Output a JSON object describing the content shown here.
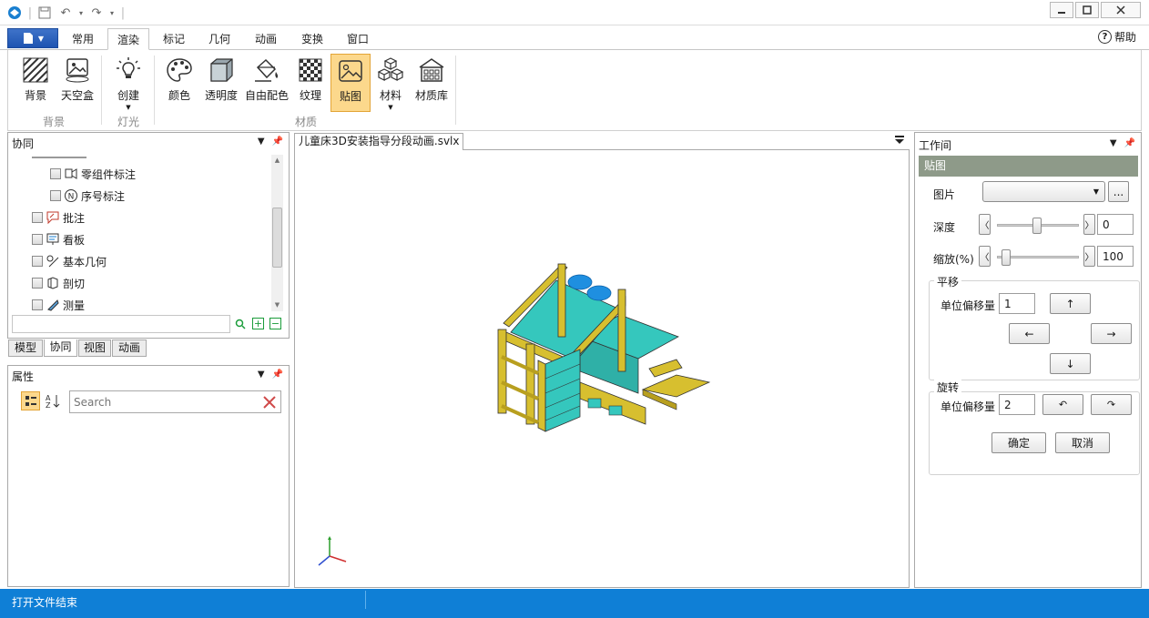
{
  "menu": {
    "tabs": [
      "常用",
      "渲染",
      "标记",
      "几何",
      "动画",
      "变换",
      "窗口"
    ],
    "active_tab": "渲染",
    "help_label": "帮助"
  },
  "ribbon": {
    "buttons": {
      "background": "背景",
      "skybox": "天空盒",
      "create": "创建",
      "color": "颜色",
      "transparency": "透明度",
      "free_color": "自由配色",
      "texture": "纹理",
      "decal": "贴图",
      "material": "材料",
      "material_library": "材质库"
    },
    "groups": {
      "background": "背景",
      "light": "灯光",
      "material": "材质"
    }
  },
  "collab_panel": {
    "title": "协同",
    "tree": [
      "零组件标注",
      "序号标注",
      "批注",
      "看板",
      "基本几何",
      "剖切",
      "测量"
    ],
    "search_placeholder": "",
    "tabs": [
      "模型",
      "协同",
      "视图",
      "动画"
    ]
  },
  "props_panel": {
    "title": "属性",
    "search_placeholder": "Search"
  },
  "viewport": {
    "doc_tab": "儿童床3D安装指导分段动画.svlx"
  },
  "workspace": {
    "title": "工作间",
    "section": "贴图",
    "image_label": "图片",
    "browse_label": "...",
    "depth_label": "深度",
    "depth_value": "0",
    "depth_level": 0.48,
    "scale_label": "缩放(%)",
    "scale_value": "100",
    "scale_level": 0.05,
    "pan_legend": "平移",
    "pan_offset_label": "单位偏移量",
    "pan_offset_value": "1",
    "rotate_legend": "旋转",
    "rotate_offset_label": "单位偏移量",
    "rotate_offset_value": "2",
    "arrows": {
      "up": "↑",
      "left": "←",
      "right": "→",
      "down": "↓"
    },
    "rotate_ccw": "↶",
    "rotate_cw": "↷",
    "ok_label": "确定",
    "cancel_label": "取消"
  },
  "status": {
    "message": "打开文件结束"
  },
  "colors": {
    "accent": "#0f7fd6",
    "active_ribbon": "#fcd88c",
    "workspace_section": "#8e9a89",
    "bed_frame": "#d7bf2f",
    "bed_mattress": "#35c7bd",
    "pillow": "#1f8fe0"
  }
}
